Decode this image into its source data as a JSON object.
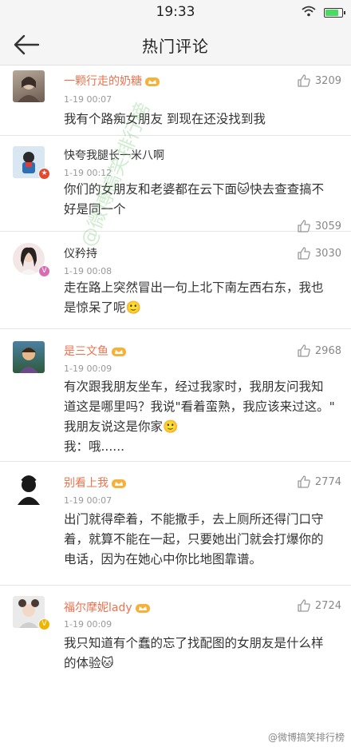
{
  "status": {
    "time": "19:33"
  },
  "nav": {
    "title": "热门评论"
  },
  "comments": [
    {
      "user": "一颗行走的奶糖",
      "time": "1-19 00:07",
      "likes": "3209",
      "text": "我有个路痴女朋友 到现在还没找到我"
    },
    {
      "user": "快夸我腿长一米八啊",
      "time": "1-19 00:12",
      "likes": "3059",
      "text": "你们的女朋友和老婆都在云下面🐱快去查查搞不好是同一个"
    },
    {
      "user": "仪矜持",
      "time": "1-19 00:08",
      "likes": "3030",
      "text": "走在路上突然冒出一句上北下南左西右东，我也是惊呆了呢🙂"
    },
    {
      "user": "是三文鱼",
      "time": "1-19 00:09",
      "likes": "2968",
      "text": "有次跟我朋友坐车，经过我家时，我朋友问我知道这是哪里吗？我说\"看着蛮熟，我应该来过这。\" 我朋友说这是你家🙂\n我：哦......"
    },
    {
      "user": "别看上我",
      "time": "1-19 00:07",
      "likes": "2774",
      "text": "出门就得牵着，不能撒手，去上厕所还得门口守着，就算不能在一起，只要她出门就会打爆你的电话，因为在她心中你比地图靠谱。"
    },
    {
      "user": "福尔摩妮lady",
      "time": "1-19 00:09",
      "likes": "2724",
      "text": "我只知道有个蠢的忘了找配图的女朋友是什么样的体验🐱"
    }
  ],
  "watermark": "@微博搞笑排行榜",
  "footer": "@微博搞笑排行榜"
}
